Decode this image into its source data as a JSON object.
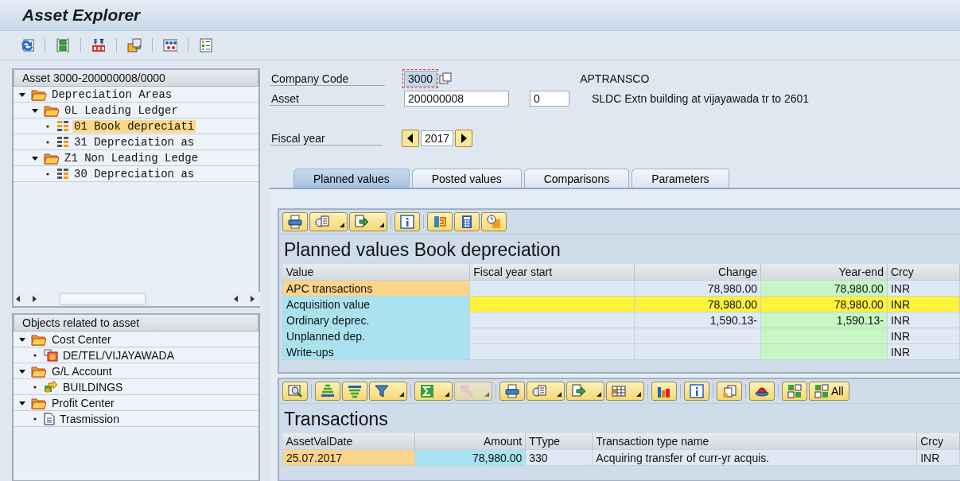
{
  "window": {
    "title": "Asset Explorer"
  },
  "asset_tree": {
    "header": "Asset 3000-200000008/0000",
    "items": [
      {
        "label": "Depreciation Areas",
        "expanded": true,
        "selected": false,
        "children": [
          {
            "label": "0L Leading Ledger",
            "expanded": true,
            "selected": false,
            "children": [
              {
                "label": "01 Book depreciati",
                "selected": true
              },
              {
                "label": "31 Depreciation as",
                "selected": false
              }
            ]
          },
          {
            "label": "Z1 Non Leading Ledge",
            "expanded": true,
            "selected": false,
            "children": [
              {
                "label": "30 Depreciation as",
                "selected": false
              }
            ]
          }
        ]
      }
    ]
  },
  "related_objects": {
    "header": "Objects related to asset",
    "items": [
      {
        "label": "Cost Center",
        "expanded": true,
        "children": [
          {
            "label": "DE/TEL/VIJAYAWADA"
          }
        ]
      },
      {
        "label": "G/L Account",
        "expanded": true,
        "children": [
          {
            "label": "BUILDINGS"
          }
        ]
      },
      {
        "label": "Profit Center",
        "expanded": true,
        "children": [
          {
            "label": "Trasmission"
          }
        ]
      }
    ]
  },
  "form": {
    "company_code": {
      "label": "Company Code",
      "value": "3000",
      "description": "APTRANSCO"
    },
    "asset": {
      "label": "Asset",
      "value": "200000008",
      "sub_number": "0",
      "description": "SLDC  Extn building at vijayawada tr to 2601"
    },
    "fiscal_year": {
      "label": "Fiscal year",
      "value": "2017"
    }
  },
  "tabs": [
    {
      "label": "Planned values",
      "selected": true
    },
    {
      "label": "Posted values",
      "selected": false
    },
    {
      "label": "Comparisons",
      "selected": false
    },
    {
      "label": "Parameters",
      "selected": false
    }
  ],
  "planned_values": {
    "title": "Planned values Book depreciation",
    "columns": [
      "Value",
      "Fiscal year start",
      "Change",
      "Year-end",
      "Crcy"
    ],
    "rows": [
      {
        "kind": "total",
        "selected": false,
        "cells": [
          "APC transactions",
          "",
          "78,980.00",
          "78,980.00",
          "INR"
        ]
      },
      {
        "kind": "line",
        "selected": true,
        "cells": [
          "Acquisition value",
          "",
          "78,980.00",
          "78,980.00",
          "INR"
        ]
      },
      {
        "kind": "line",
        "selected": false,
        "cells": [
          "Ordinary deprec.",
          "",
          "1,590.13-",
          "1,590.13-",
          "INR"
        ]
      },
      {
        "kind": "line",
        "selected": false,
        "cells": [
          "Unplanned dep.",
          "",
          "",
          "",
          "INR"
        ]
      },
      {
        "kind": "line",
        "selected": false,
        "cells": [
          "Write-ups",
          "",
          "",
          "",
          "INR"
        ]
      }
    ]
  },
  "transactions": {
    "title": "Transactions",
    "select_all_label": "All",
    "columns": [
      "AssetValDate",
      "Amount",
      "TType",
      "Transaction type name",
      "Crcy"
    ],
    "rows": [
      {
        "cells": [
          "25.07.2017",
          "78,980.00",
          "330",
          "Acquiring transfer of curr-yr acquis.",
          "INR"
        ]
      }
    ]
  }
}
